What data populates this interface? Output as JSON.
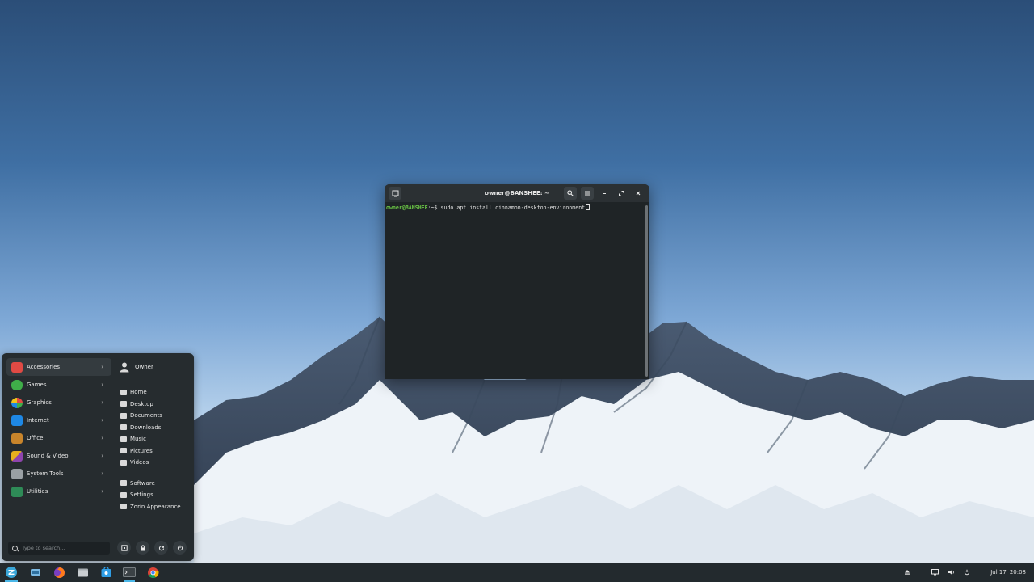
{
  "terminal": {
    "title": "owner@BANSHEE: ~",
    "prompt_user": "owner@BANSHEE",
    "prompt_path": ":~$",
    "command": " sudo apt install cinnamon-desktop-environment"
  },
  "menu": {
    "categories": [
      {
        "label": "Accessories",
        "color": "#e04a44"
      },
      {
        "label": "Games",
        "color": "#3fae49"
      },
      {
        "label": "Graphics",
        "color": "#f0f0f0"
      },
      {
        "label": "Internet",
        "color": "#1e88e5"
      },
      {
        "label": "Office",
        "color": "#c9852b"
      },
      {
        "label": "Sound & Video",
        "color": "#e6b01e"
      },
      {
        "label": "System Tools",
        "color": "#9aa0a4"
      },
      {
        "label": "Utilities",
        "color": "#2e8b57"
      }
    ],
    "arrow": "›",
    "user": "Owner",
    "places": [
      "Home",
      "Desktop",
      "Documents",
      "Downloads",
      "Music",
      "Pictures",
      "Videos"
    ],
    "system": [
      "Software",
      "Settings",
      "Zorin Appearance"
    ],
    "search_placeholder": "Type to search..."
  },
  "taskbar": {
    "date": "Jul 17",
    "time": "20:08",
    "apps": [
      "zorin-menu-icon",
      "workspaces-icon",
      "firefox-icon",
      "files-icon",
      "store-icon",
      "terminal-icon",
      "chrome-icon"
    ]
  }
}
